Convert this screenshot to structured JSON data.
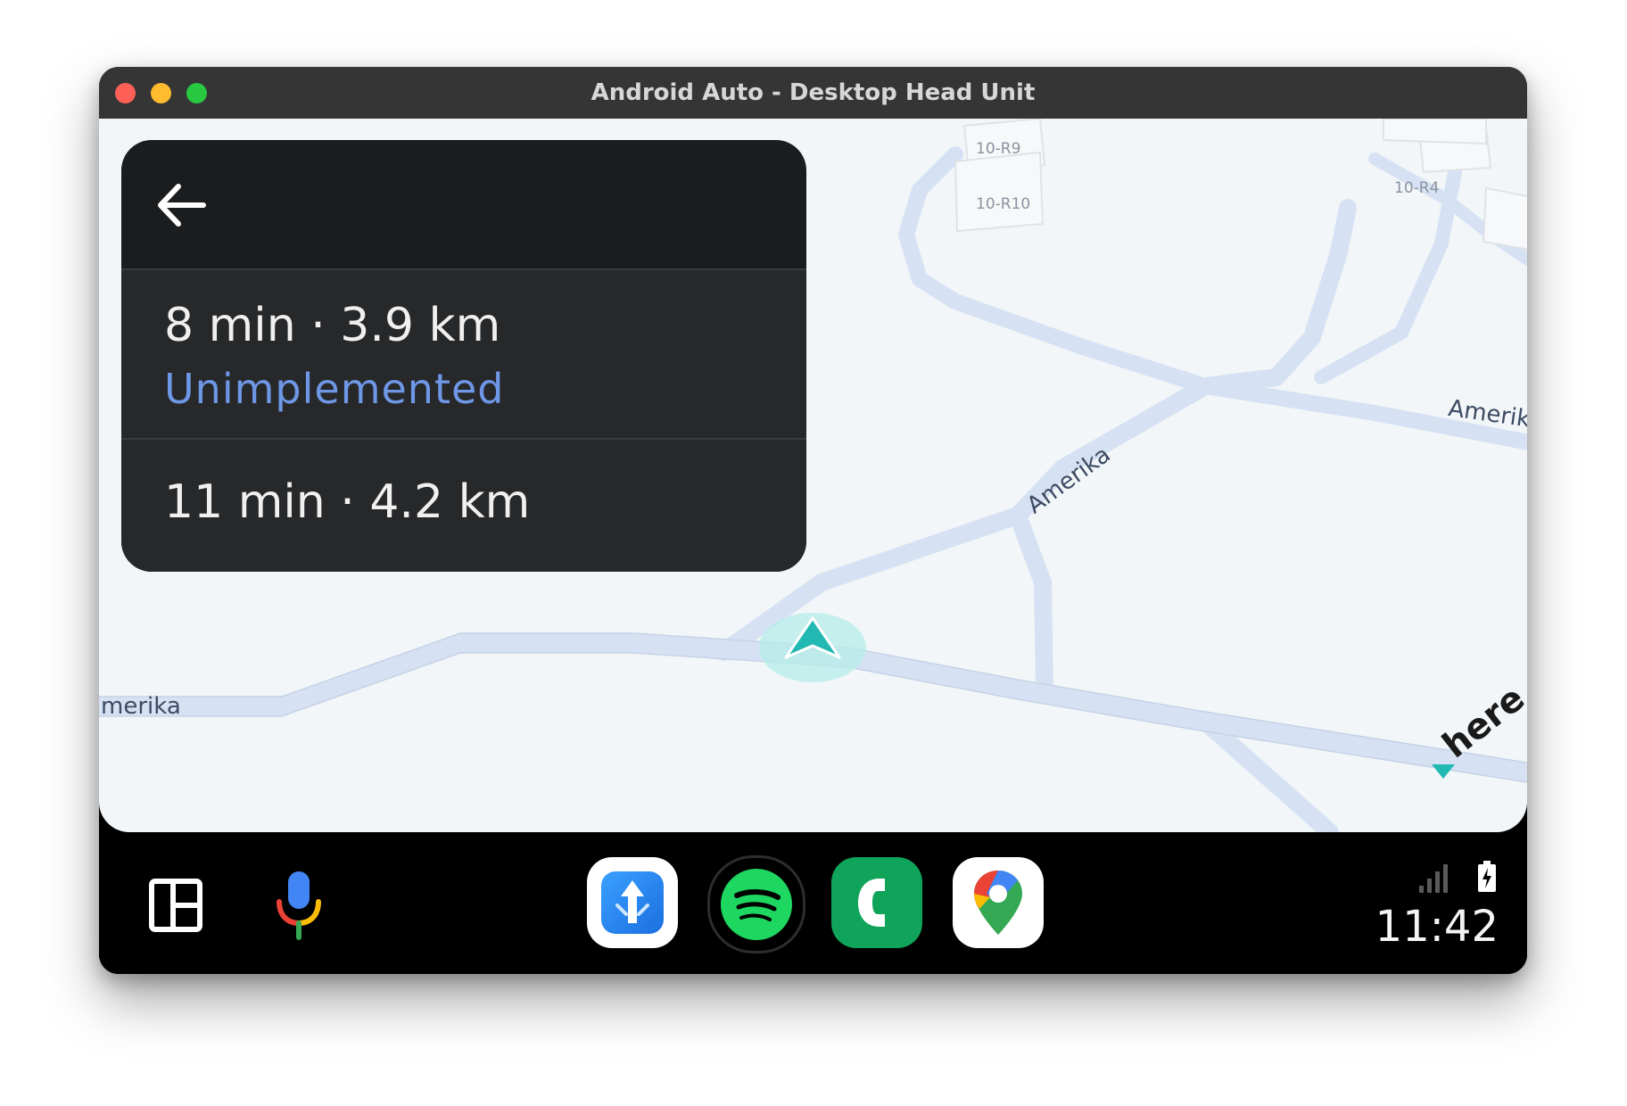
{
  "window": {
    "title": "Android Auto - Desktop Head Unit"
  },
  "map": {
    "road_labels": {
      "amerika_left": "merika",
      "amerika_center": "Amerika",
      "amerika_right": "Amerik"
    },
    "building_labels": [
      "10-R9",
      "10-R10",
      "10-R4"
    ],
    "provider_logo": "here",
    "location_marker": "navigation-arrow"
  },
  "routes": {
    "back_icon": "arrow-back-icon",
    "items": [
      {
        "summary": "8 min · 3.9 km",
        "note": "Unimplemented"
      },
      {
        "summary": "11 min · 4.2 km"
      }
    ]
  },
  "dock": {
    "apps": [
      "navigation-app-icon",
      "spotify-icon",
      "phone-icon",
      "google-maps-icon"
    ],
    "time": "11:42"
  },
  "colors": {
    "accent_blue": "#6e97e6",
    "card_bg": "#1b1c1e",
    "row_bg": "#27282a",
    "map_bg": "#f2f6f8",
    "road": "#d6e2f3",
    "marker": "#21b9b2"
  }
}
